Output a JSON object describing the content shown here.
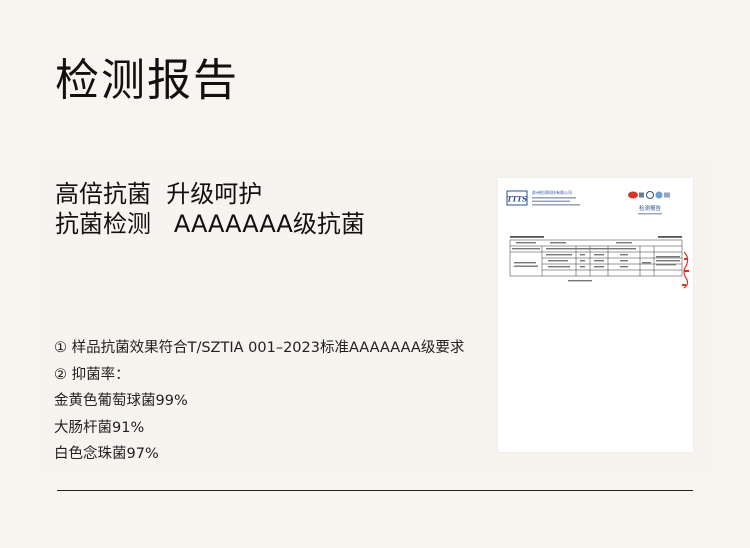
{
  "title": "检测报告",
  "headline": {
    "line1": "高倍抗菌  升级呵护",
    "line2": "抗菌检测   AAAAAAA级抗菌"
  },
  "facts": [
    "① 样品抗菌效果符合T/SZTIA 001–2023标准AAAAAAA级要求",
    "② 抑菌率：",
    "金黄色葡萄球菌99%",
    "大肠杆菌91%",
    "白色念珠菌97%"
  ],
  "report": {
    "logo": "TTTS",
    "org_line": "苏州检测科技有限公司",
    "badge": "检测报告",
    "colors": {
      "accent": "#2a4f93",
      "stamp": "#d9342b"
    }
  }
}
